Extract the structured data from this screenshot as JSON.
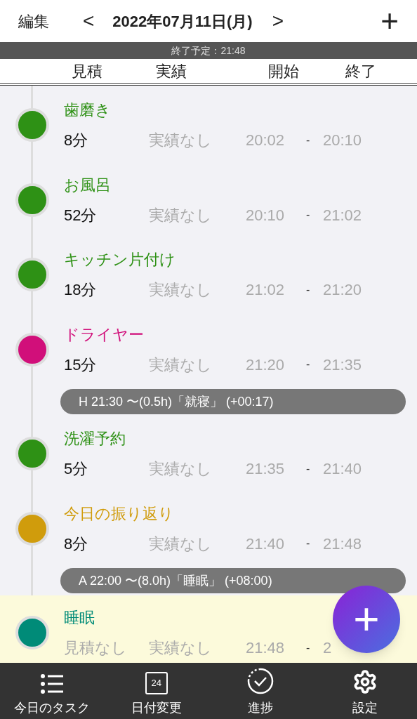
{
  "header": {
    "edit": "編集",
    "prev": "<",
    "date": "2022年07月11日(月)",
    "next": ">",
    "add": "+"
  },
  "status": "終了予定：21:48",
  "columns": [
    "見積",
    "実績",
    "開始",
    "終了"
  ],
  "items": [
    {
      "kind": "task",
      "name": "歯磨き",
      "color": "#2e9115",
      "estimate": "8分",
      "estimated": true,
      "actual": "実績なし",
      "start": "20:02",
      "dash": "-",
      "end": "20:10",
      "current": false
    },
    {
      "kind": "task",
      "name": "お風呂",
      "color": "#2e9115",
      "estimate": "52分",
      "estimated": true,
      "actual": "実績なし",
      "start": "20:10",
      "dash": "-",
      "end": "21:02",
      "current": false
    },
    {
      "kind": "task",
      "name": "キッチン片付け",
      "color": "#2e9115",
      "estimate": "18分",
      "estimated": true,
      "actual": "実績なし",
      "start": "21:02",
      "dash": "-",
      "end": "21:20",
      "current": false
    },
    {
      "kind": "task",
      "name": "ドライヤー",
      "color": "#d10f7a",
      "estimate": "15分",
      "estimated": true,
      "actual": "実績なし",
      "start": "21:20",
      "dash": "-",
      "end": "21:35",
      "current": false
    },
    {
      "kind": "note",
      "text": "H 21:30 〜(0.5h)「就寝」 (+00:17)"
    },
    {
      "kind": "task",
      "name": "洗濯予約",
      "color": "#2e9115",
      "estimate": "5分",
      "estimated": true,
      "actual": "実績なし",
      "start": "21:35",
      "dash": "-",
      "end": "21:40",
      "current": false
    },
    {
      "kind": "task",
      "name": "今日の振り返り",
      "color": "#d09c0c",
      "estimate": "8分",
      "estimated": true,
      "actual": "実績なし",
      "start": "21:40",
      "dash": "-",
      "end": "21:48",
      "current": false
    },
    {
      "kind": "note",
      "text": "A 22:00 〜(8.0h)「睡眠」 (+08:00)"
    },
    {
      "kind": "task",
      "name": "睡眠",
      "color": "#008b78",
      "estimate": "見積なし",
      "estimated": false,
      "actual": "実績なし",
      "start": "21:48",
      "dash": "-",
      "end": "2",
      "current": true
    }
  ],
  "fab": "+",
  "tabs": [
    {
      "kind": "list",
      "label": "今日のタスク"
    },
    {
      "kind": "calendar",
      "label": "日付変更",
      "badge": "24"
    },
    {
      "kind": "progress",
      "label": "進捗"
    },
    {
      "kind": "gear",
      "label": "設定"
    }
  ]
}
